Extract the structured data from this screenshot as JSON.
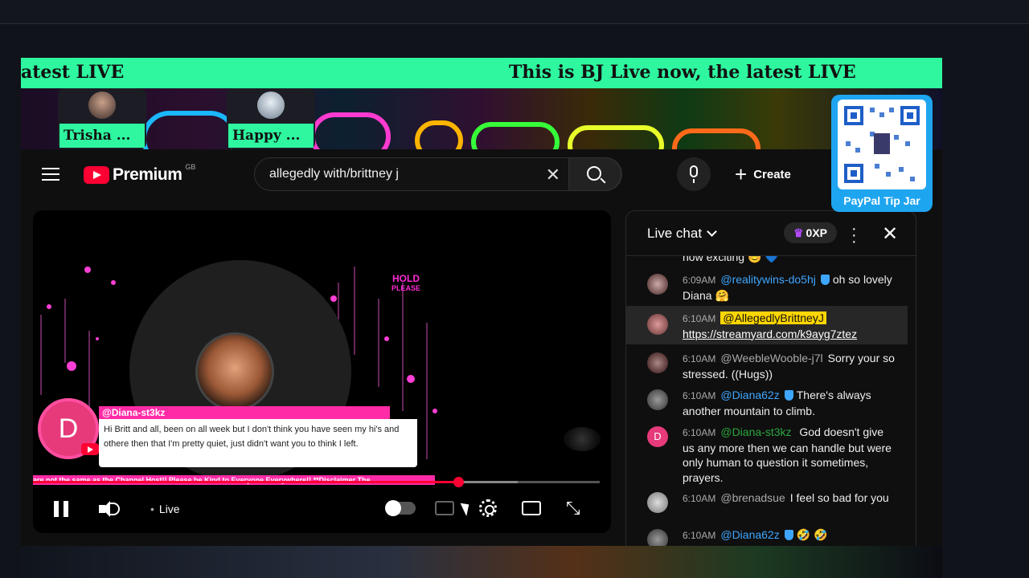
{
  "ticker": {
    "text_left": "atest LIVE",
    "text_right": "This is BJ Live now, the latest LIVE"
  },
  "guests": [
    {
      "name": "Trisha ..."
    },
    {
      "name": "Happy ..."
    }
  ],
  "youtube": {
    "brand": "Premium",
    "region": "GB",
    "search_value": "allegedly with/brittney j",
    "create_label": "Create"
  },
  "player": {
    "hold_title": "HOLD",
    "hold_sub": "PLEASE",
    "comment": {
      "initial": "D",
      "author": "@Diana-st3kz",
      "text": "Hi Britt and all, been on all week but I don't think you have seen my hi's and othere then that I'm pretty quiet, just didn't want you to think I left."
    },
    "crawl_text": "are not the same as the Channel Host!! Please be Kind to Everyone Everywhere!! **Disclaimer The",
    "live_label": "Live",
    "progress_fraction": 0.75
  },
  "chat": {
    "title": "Live chat",
    "xp": "0XP",
    "partial_text": "now exciting",
    "messages": [
      {
        "time": "6:09AM",
        "author": "@realitywins-do5hj",
        "style": "mem",
        "text": "oh so lovely Diana 🤗"
      },
      {
        "time": "6:10AM",
        "author": "@AllegedlyBrittneyJ",
        "style": "hi",
        "text": "https://streamyard.com/k9ayg7ztez"
      },
      {
        "time": "6:10AM",
        "author": "@WeebleWooble-j7l",
        "style": "plain",
        "text": "Sorry your so stressed. ((Hugs))"
      },
      {
        "time": "6:10AM",
        "author": "@Diana62z",
        "style": "mem",
        "text": "There's always another mountain to climb."
      },
      {
        "time": "6:10AM",
        "author": "@Diana-st3kz",
        "style": "own",
        "text": "God doesn't give us any more then we can handle but were only human to question it sometimes, prayers."
      },
      {
        "time": "6:10AM",
        "author": "@brenadsue",
        "style": "plain",
        "text": "I feel so bad for you"
      },
      {
        "time": "6:10AM",
        "author": "@Diana62z",
        "style": "mem",
        "text": "🤣 🤣"
      }
    ]
  },
  "qr": {
    "label": "PayPal Tip Jar"
  },
  "colors": {
    "ticker_bg": "#2ef7a0",
    "accent_pink": "#ff2ba6",
    "yt_red": "#ff0033",
    "paypal_blue": "#1ea5f0"
  },
  "icons": [
    "menu-icon",
    "search-icon",
    "clear-icon",
    "mic-icon",
    "plus-icon",
    "pause-icon",
    "volume-icon",
    "settings-icon",
    "theater-icon",
    "fullscreen-icon",
    "chevron-down-icon",
    "crown-icon",
    "more-icon",
    "close-icon"
  ]
}
